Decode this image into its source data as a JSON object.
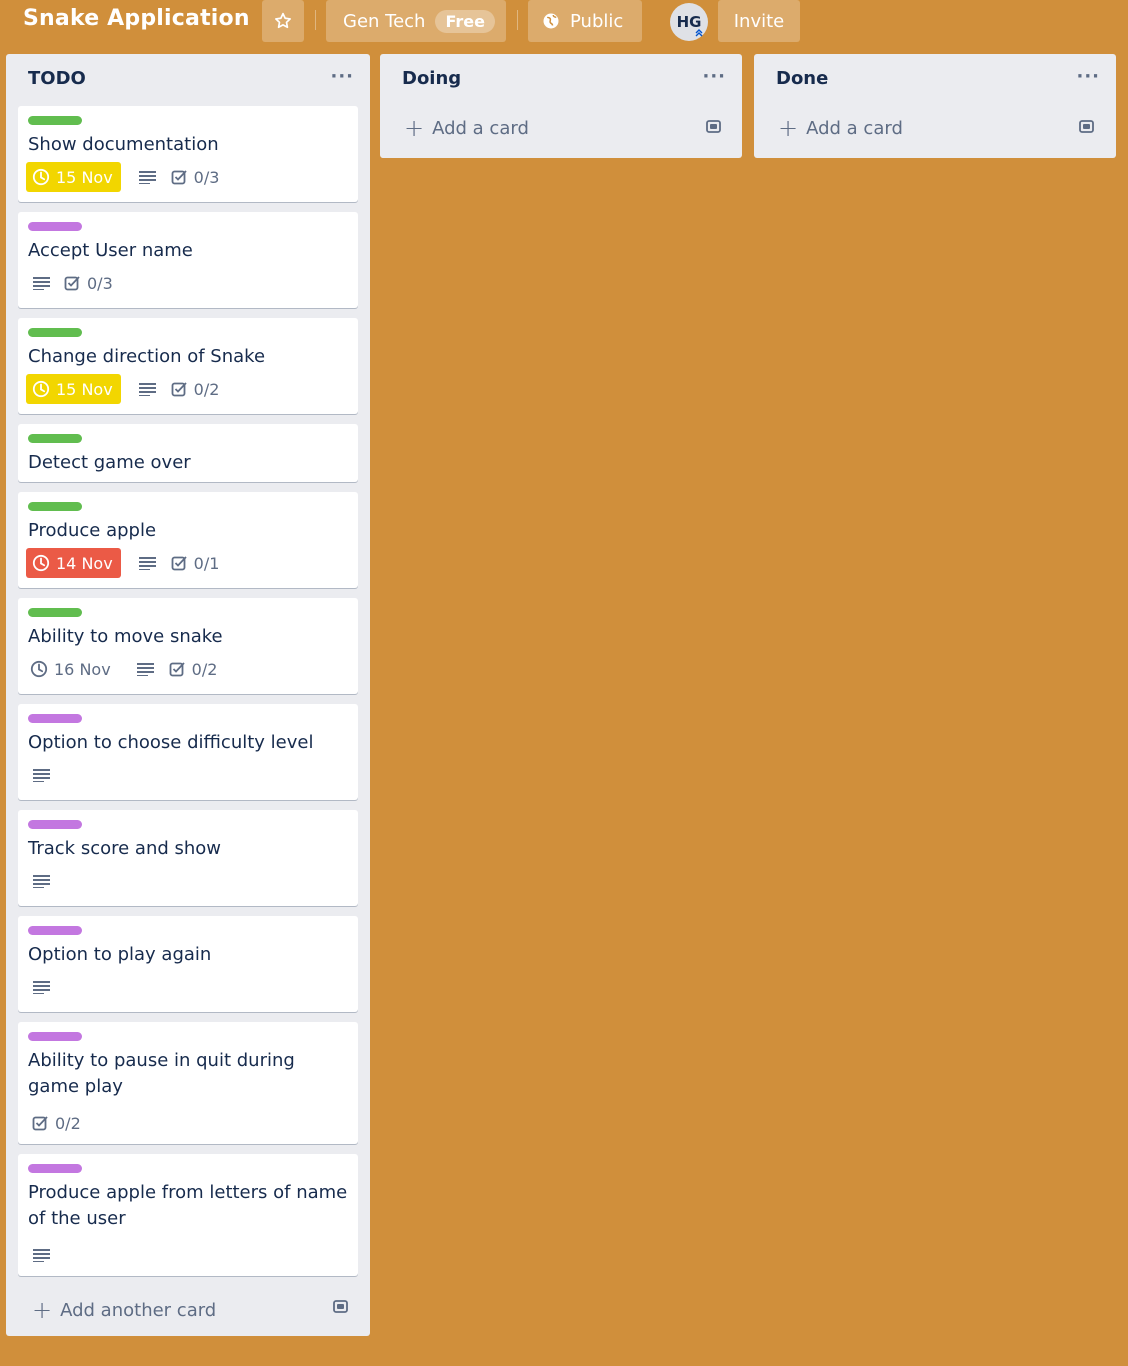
{
  "header": {
    "board_title": "Snake Application",
    "team_name": "Gen Tech",
    "team_plan": "Free",
    "visibility": "Public",
    "avatar_initials": "HG",
    "invite_label": "Invite"
  },
  "colors": {
    "background": "#d08f3b",
    "label_green": "#61bd4f",
    "label_purple": "#c377e0",
    "due_soon": "#f2d600",
    "due_overdue": "#eb5a46"
  },
  "lists": [
    {
      "title": "TODO",
      "add_label": "Add another card",
      "cards": [
        {
          "title": "Show documentation",
          "label": "green",
          "due": "15 Nov",
          "due_status": "soon",
          "description": true,
          "checklist": "0/3"
        },
        {
          "title": "Accept User name",
          "label": "purple",
          "due": "",
          "due_status": "",
          "description": true,
          "checklist": "0/3"
        },
        {
          "title": "Change direction of Snake",
          "label": "green",
          "due": "15 Nov",
          "due_status": "soon",
          "description": true,
          "checklist": "0/2"
        },
        {
          "title": "Detect game over",
          "label": "green",
          "due": "",
          "due_status": "",
          "description": false,
          "checklist": ""
        },
        {
          "title": "Produce apple",
          "label": "green",
          "due": "14 Nov",
          "due_status": "overdue",
          "description": true,
          "checklist": "0/1"
        },
        {
          "title": "Ability to move snake",
          "label": "green",
          "due": "16 Nov",
          "due_status": "normal",
          "description": true,
          "checklist": "0/2"
        },
        {
          "title": "Option to choose difficulty level",
          "label": "purple",
          "due": "",
          "due_status": "",
          "description": true,
          "checklist": ""
        },
        {
          "title": "Track score and show",
          "label": "purple",
          "due": "",
          "due_status": "",
          "description": true,
          "checklist": ""
        },
        {
          "title": "Option to play again",
          "label": "purple",
          "due": "",
          "due_status": "",
          "description": true,
          "checklist": ""
        },
        {
          "title": "Ability to pause in quit during game play",
          "label": "purple",
          "due": "",
          "due_status": "",
          "description": false,
          "checklist": "0/2"
        },
        {
          "title": "Produce apple from letters of name of the user",
          "label": "purple",
          "due": "",
          "due_status": "",
          "description": true,
          "checklist": ""
        }
      ]
    },
    {
      "title": "Doing",
      "add_label": "Add a card",
      "cards": []
    },
    {
      "title": "Done",
      "add_label": "Add a card",
      "cards": []
    }
  ]
}
